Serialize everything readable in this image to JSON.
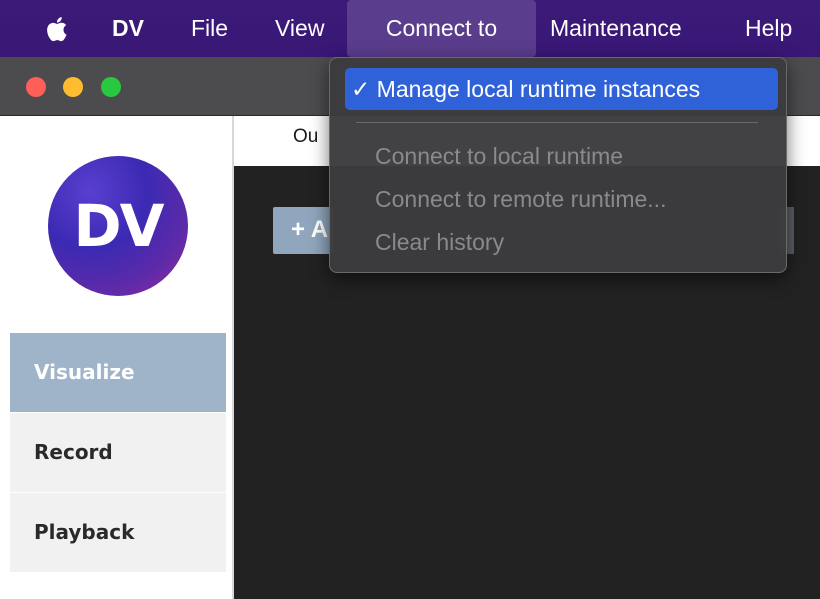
{
  "menubar": {
    "apple_icon": "apple-icon",
    "app_name": "DV",
    "items": [
      "File",
      "View",
      "Connect to",
      "Maintenance",
      "Help"
    ]
  },
  "window": {
    "traffic_lights": [
      "red",
      "yellow",
      "green"
    ]
  },
  "sidebar": {
    "logo_text": "DV",
    "items": [
      {
        "label": "Visualize",
        "active": true
      },
      {
        "label": "Record",
        "active": false
      },
      {
        "label": "Playback",
        "active": false
      }
    ]
  },
  "main": {
    "tab_label_partial": "Ou",
    "add_button_label": "+ A"
  },
  "dropdown": {
    "items": [
      {
        "label": "✓ Manage local runtime instances",
        "enabled": true,
        "checked": true
      },
      {
        "label": "Connect to local runtime",
        "enabled": false
      },
      {
        "label": "Connect to remote runtime...",
        "enabled": false
      },
      {
        "label": "Clear history",
        "enabled": false
      }
    ]
  },
  "colors": {
    "menubar": "#3b1a78",
    "selected_item": "#2f62d9",
    "sidebar_active": "#9fb4c9",
    "content_bg": "#222222"
  }
}
